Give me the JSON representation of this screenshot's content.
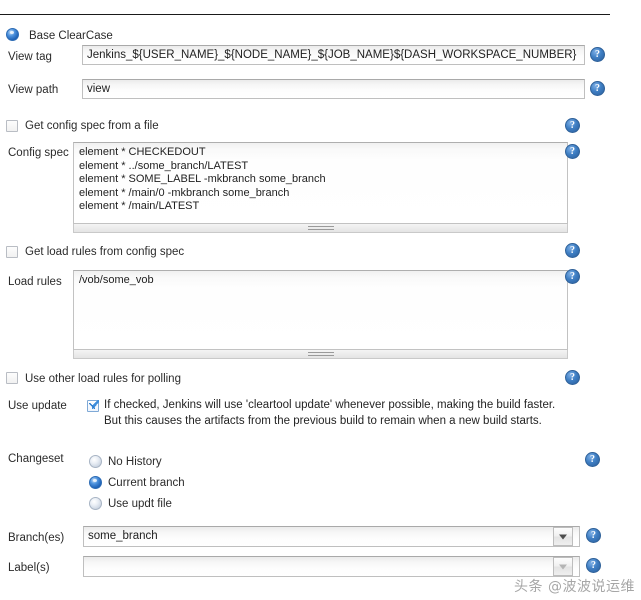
{
  "form": {
    "scm_option": {
      "label": "Base ClearCase",
      "selected": true
    },
    "view_tag": {
      "label": "View tag",
      "value": "Jenkins_${USER_NAME}_${NODE_NAME}_${JOB_NAME}${DASH_WORKSPACE_NUMBER}"
    },
    "view_path": {
      "label": "View path",
      "value": "view"
    },
    "get_config_spec_from_file": {
      "label": "Get config spec from a file",
      "checked": false
    },
    "config_spec": {
      "label": "Config spec",
      "value": "element * CHECKEDOUT\nelement * ../some_branch/LATEST\nelement * SOME_LABEL -mkbranch some_branch\nelement * /main/0 -mkbranch some_branch\nelement * /main/LATEST"
    },
    "get_load_rules_from_config_spec": {
      "label": "Get load rules from config spec",
      "checked": false
    },
    "load_rules": {
      "label": "Load rules",
      "value": "/vob/some_vob"
    },
    "use_other_load_rules_for_polling": {
      "label": "Use other load rules for polling",
      "checked": false
    },
    "use_update": {
      "label": "Use update",
      "checked": true,
      "description": "If checked, Jenkins will use 'cleartool update' whenever possible, making the build faster. But this causes the artifacts from the previous build to remain when a new build starts."
    },
    "changeset": {
      "label": "Changeset",
      "options": [
        {
          "label": "No History",
          "selected": false
        },
        {
          "label": "Current branch",
          "selected": true
        },
        {
          "label": "Use updt file",
          "selected": false
        }
      ]
    },
    "branches": {
      "label": "Branch(es)",
      "value": "some_branch",
      "placeholder": ""
    },
    "labels": {
      "label": "Label(s)",
      "value": "",
      "placeholder": ""
    }
  },
  "icons": {
    "help": "?",
    "help_name": "help-icon",
    "dropdown_arrow": "▼"
  },
  "watermark": "头条 @波波说运维"
}
